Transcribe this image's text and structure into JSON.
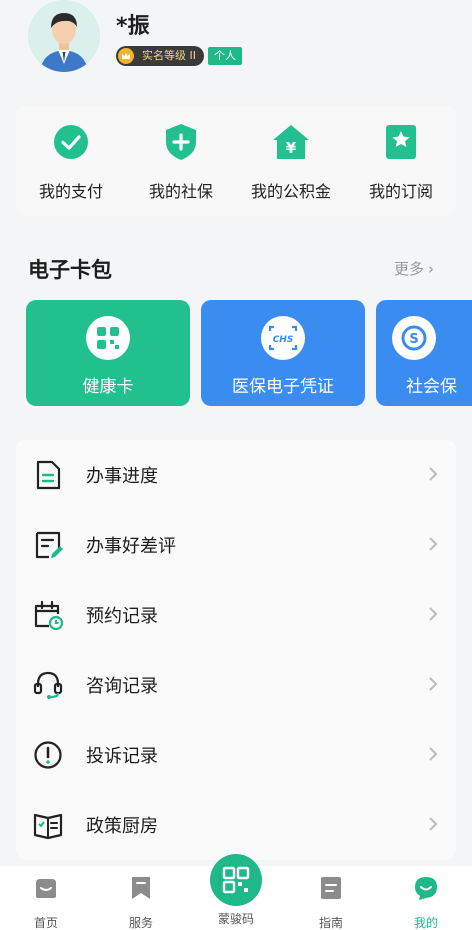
{
  "profile": {
    "name": "*振",
    "verify_level": "实名等级 II",
    "account_type": "个人"
  },
  "quick_actions": [
    {
      "label": "我的支付",
      "icon": "check-circle-icon"
    },
    {
      "label": "我的社保",
      "icon": "shield-plus-icon"
    },
    {
      "label": "我的公积金",
      "icon": "house-yuan-icon"
    },
    {
      "label": "我的订阅",
      "icon": "bookmark-star-icon"
    }
  ],
  "wallet": {
    "title": "电子卡包",
    "more": "更多",
    "cards": [
      {
        "label": "健康卡",
        "color": "#22c08f",
        "icon": "health-card-icon"
      },
      {
        "label": "医保电子凭证",
        "color": "#3b8cf0",
        "icon": "chs-icon"
      },
      {
        "label": "社会保",
        "color": "#3b8cf0",
        "icon": "social-security-icon"
      }
    ]
  },
  "records": [
    {
      "label": "办事进度",
      "icon": "document-icon"
    },
    {
      "label": "办事好差评",
      "icon": "review-icon"
    },
    {
      "label": "预约记录",
      "icon": "calendar-clock-icon"
    },
    {
      "label": "咨询记录",
      "icon": "headset-icon"
    },
    {
      "label": "投诉记录",
      "icon": "alert-circle-icon"
    },
    {
      "label": "政策厨房",
      "icon": "open-book-icon"
    }
  ],
  "tabbar": {
    "home": "首页",
    "service": "服务",
    "code": "蒙骏码",
    "guide": "指南",
    "mine": "我的"
  },
  "colors": {
    "accent": "#1fb889",
    "health_card": "#22c08f",
    "medical_card": "#3b8cf0"
  }
}
